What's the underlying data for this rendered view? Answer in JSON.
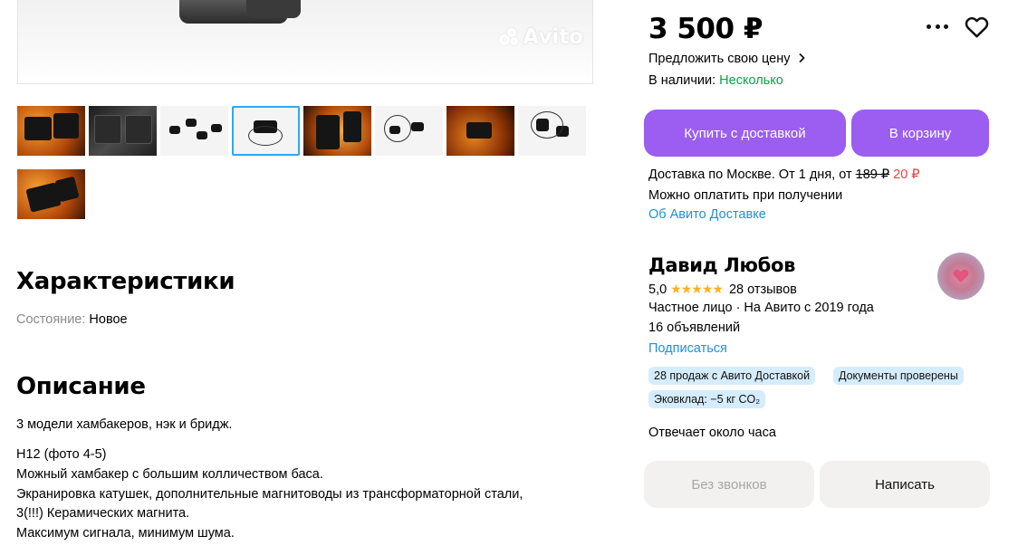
{
  "gallery": {
    "watermark": "Avito",
    "thumbnails": [
      "thumb-1",
      "thumb-2",
      "thumb-3",
      "thumb-4",
      "thumb-5",
      "thumb-6",
      "thumb-7",
      "thumb-8",
      "thumb-9"
    ],
    "selected_index": 3
  },
  "characteristics": {
    "title": "Характеристики",
    "condition_label": "Состояние:",
    "condition_value": "Новое"
  },
  "description": {
    "title": "Описание",
    "intro": "3 модели хамбакеров, нэк и бридж.",
    "lines": [
      "H12 (фото 4-5)",
      "Можный хамбакер с большим колличеством баса.",
      "Экранировка катушек, дополнительные магнитоводы из трансформаторной стали,",
      "3(!!!) Керамических магнита.",
      "Максимум сигнала, минимум шума."
    ]
  },
  "product": {
    "price": "3 500 ₽",
    "offer_price_link": "Предложить свою цену",
    "availability_label": "В наличии:",
    "availability_value": "Несколько",
    "buy_delivery_button": "Купить с доставкой",
    "cart_button": "В корзину",
    "delivery_prefix": "Доставка по Москве. От 1 дня, от",
    "delivery_old_price": "189 ₽",
    "delivery_new_price": "20 ₽",
    "pay_on_receipt": "Можно оплатить при получении",
    "about_delivery_link": "Об Авито Доставке"
  },
  "seller": {
    "name": "Давид Любов",
    "rating": "5,0",
    "stars": "★★★★★",
    "reviews": "28 отзывов",
    "type": "Частное лицо · На Авито с 2019 года",
    "ads_count": "16 объявлений",
    "subscribe": "Подписаться",
    "badges": [
      "28 продаж с Авито Доставкой",
      "Документы проверены",
      "Эковклад: −5 кг CO₂"
    ],
    "responds": "Отвечает около часа",
    "no_calls_button": "Без звонков",
    "write_button": "Написать"
  },
  "icons": [
    "more-icon",
    "heart-icon",
    "chevron-right-icon",
    "star-icon",
    "avito-logo-icon"
  ],
  "colors": {
    "accent_purple": "#9b5ef0",
    "link_blue": "#1f8fe0",
    "available_green": "#02a845",
    "sale_red": "#f04040",
    "badge_blue": "#d5ecfc",
    "stars_yellow": "#ffb021"
  }
}
